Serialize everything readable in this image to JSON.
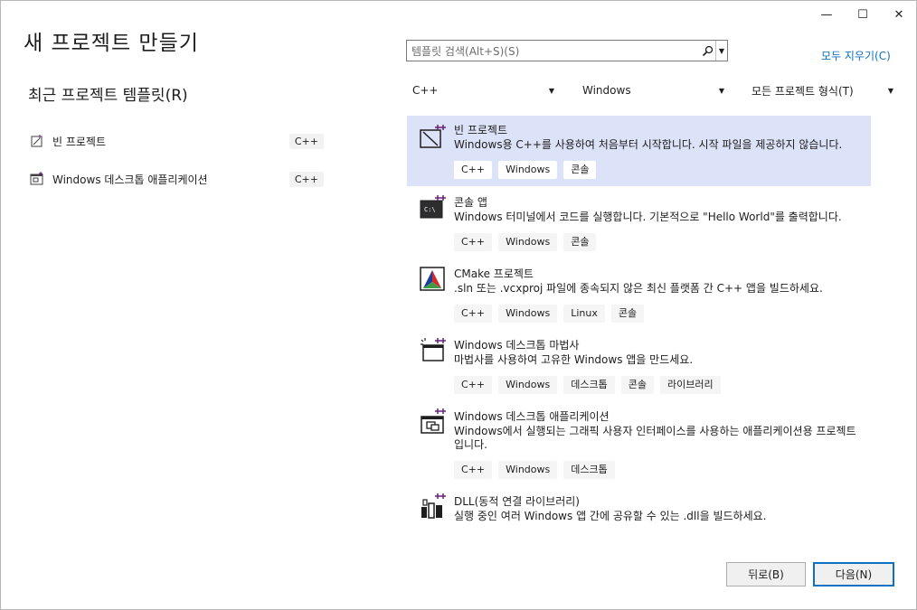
{
  "window": {
    "title": "새 프로젝트 만들기",
    "controls": {
      "minimize": "—",
      "maximize": "☐",
      "close": "✕"
    }
  },
  "recent": {
    "heading": "최근 프로젝트 템플릿(R)",
    "items": [
      {
        "label": "빈 프로젝트",
        "tag": "C++",
        "icon": "empty-project-icon"
      },
      {
        "label": "Windows 데스크톱 애플리케이션",
        "tag": "C++",
        "icon": "desktop-app-icon"
      }
    ]
  },
  "search": {
    "placeholder": "템플릿 검색(Alt+S)(S)"
  },
  "clear_all": "모두 지우기(C)",
  "filters": {
    "language": "C++",
    "platform": "Windows",
    "project_type": "모든 프로젝트 형식(T)"
  },
  "templates": [
    {
      "name": "빈 프로젝트",
      "description": "Windows용 C++를 사용하여 처음부터 시작합니다. 시작 파일을 제공하지 않습니다.",
      "tags": [
        "C++",
        "Windows",
        "콘솔"
      ],
      "icon": "empty-project-icon",
      "selected": true
    },
    {
      "name": "콘솔 앱",
      "description": "Windows 터미널에서 코드를 실행합니다. 기본적으로 \"Hello World\"를 출력합니다.",
      "tags": [
        "C++",
        "Windows",
        "콘솔"
      ],
      "icon": "console-app-icon"
    },
    {
      "name": "CMake 프로젝트",
      "description": ".sln 또는 .vcxproj 파일에 종속되지 않은 최신 플랫폼 간 C++ 앱을 빌드하세요.",
      "tags": [
        "C++",
        "Windows",
        "Linux",
        "콘솔"
      ],
      "icon": "cmake-icon"
    },
    {
      "name": "Windows 데스크톱 마법사",
      "description": "마법사를 사용하여 고유한 Windows 앱을 만드세요.",
      "tags": [
        "C++",
        "Windows",
        "데스크톱",
        "콘솔",
        "라이브러리"
      ],
      "icon": "wizard-icon"
    },
    {
      "name": "Windows 데스크톱 애플리케이션",
      "description": "Windows에서 실행되는 그래픽 사용자 인터페이스를 사용하는 애플리케이션용 프로젝트입니다.",
      "tags": [
        "C++",
        "Windows",
        "데스크톱"
      ],
      "icon": "desktop-app-icon"
    },
    {
      "name": "DLL(동적 연결 라이브러리)",
      "description": "실행 중인 여러 Windows 앱 간에 공유할 수 있는 .dll을 빌드하세요.",
      "tags": [],
      "icon": "dll-icon"
    }
  ],
  "buttons": {
    "back": "뒤로(B)",
    "next": "다음(N)"
  },
  "colors": {
    "accent": "#0e70c0",
    "selected_bg": "#dce3f8",
    "template_icon_accent": "#68217a"
  }
}
